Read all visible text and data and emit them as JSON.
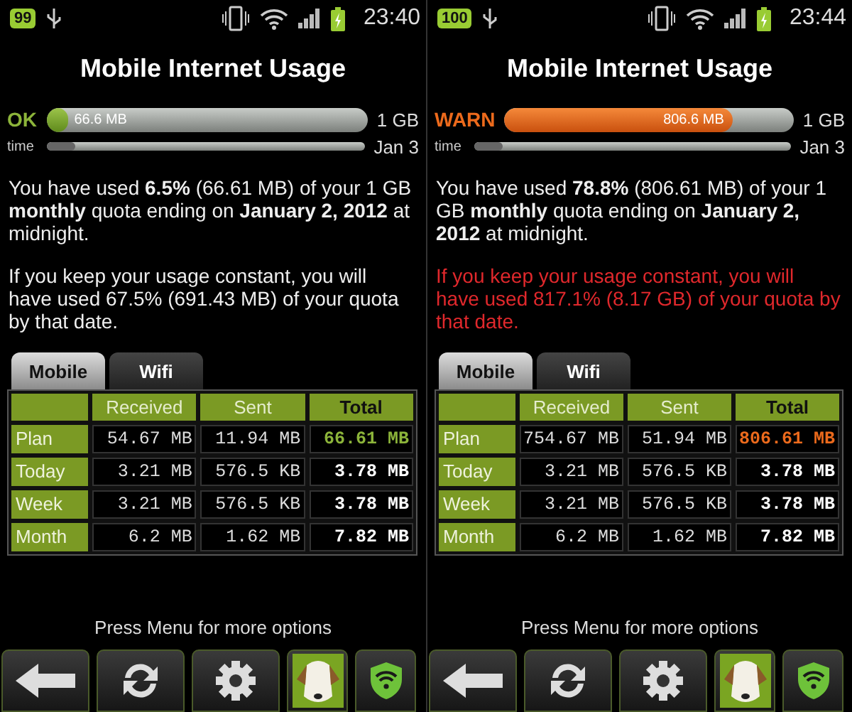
{
  "screens": [
    {
      "status_bar": {
        "battery_badge": "99",
        "time": "23:40"
      },
      "title": "Mobile Internet Usage",
      "usage": {
        "status": "OK",
        "kind": "ok",
        "level": 0.065,
        "amount": "66.6 MB",
        "limit": "1 GB"
      },
      "time_bar": {
        "label": "time",
        "level": 0.09,
        "end": "Jan 3"
      },
      "summary": "You have used **6.5%** (66.61 MB) of your 1 GB **monthly** quota ending on **January 2, 2012** at midnight.",
      "projection": {
        "text": "If you keep your usage constant, you will have used 67.5% (691.43 MB) of your quota by that date.",
        "warning": false
      },
      "tabs": [
        {
          "label": "Mobile",
          "selected": true
        },
        {
          "label": "Wifi",
          "selected": false
        }
      ],
      "columns": [
        "Received",
        "Sent",
        "Total"
      ],
      "rows": [
        {
          "label": "Plan",
          "values": [
            "54.67 MB",
            "11.94 MB",
            "66.61 MB"
          ],
          "highlight": true
        },
        {
          "label": "Today",
          "values": [
            "3.21 MB",
            "576.5 KB",
            "3.78 MB"
          ],
          "highlight": false
        },
        {
          "label": "Week",
          "values": [
            "3.21 MB",
            "576.5 KB",
            "3.78 MB"
          ],
          "highlight": false
        },
        {
          "label": "Month",
          "values": [
            "6.2 MB",
            "1.62 MB",
            "7.82 MB"
          ],
          "highlight": false
        }
      ],
      "hint": "Press Menu for more options"
    },
    {
      "status_bar": {
        "battery_badge": "100",
        "time": "23:44"
      },
      "title": "Mobile Internet Usage",
      "usage": {
        "status": "WARN",
        "kind": "warn",
        "level": 0.788,
        "amount": "806.6 MB",
        "limit": "1 GB"
      },
      "time_bar": {
        "label": "time",
        "level": 0.09,
        "end": "Jan 3"
      },
      "summary": "You have used **78.8%** (806.61 MB) of your 1 GB **monthly** quota ending on **January 2, 2012** at midnight.",
      "projection": {
        "text": "If you keep your usage constant, you will have used 817.1% (8.17 GB) of your quota by that date.",
        "warning": true
      },
      "tabs": [
        {
          "label": "Mobile",
          "selected": true
        },
        {
          "label": "Wifi",
          "selected": false
        }
      ],
      "columns": [
        "Received",
        "Sent",
        "Total"
      ],
      "rows": [
        {
          "label": "Plan",
          "values": [
            "754.67 MB",
            "51.94 MB",
            "806.61 MB"
          ],
          "highlight": true
        },
        {
          "label": "Today",
          "values": [
            "3.21 MB",
            "576.5 KB",
            "3.78 MB"
          ],
          "highlight": false
        },
        {
          "label": "Week",
          "values": [
            "3.21 MB",
            "576.5 KB",
            "3.78 MB"
          ],
          "highlight": false
        },
        {
          "label": "Month",
          "values": [
            "6.2 MB",
            "1.62 MB",
            "7.82 MB"
          ],
          "highlight": false
        }
      ],
      "hint": "Press Menu for more options"
    }
  ]
}
